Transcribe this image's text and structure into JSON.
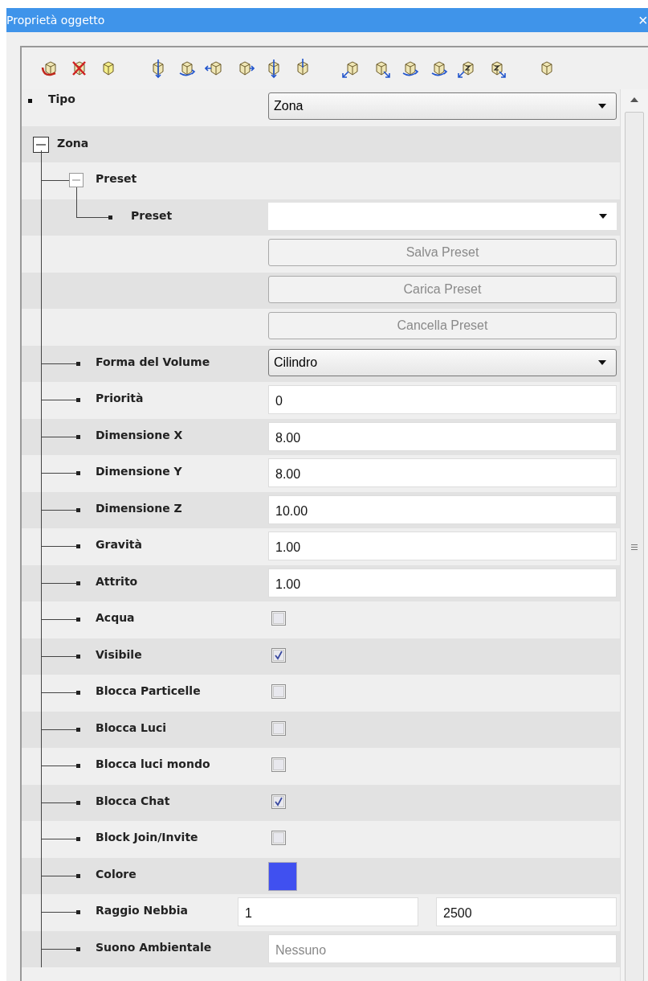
{
  "window": {
    "title": "Proprietà oggetto",
    "close": "×"
  },
  "type_row": {
    "label": "Tipo",
    "value": "Zona"
  },
  "tree": {
    "label": "Zona",
    "expanded": true,
    "children": [
      {
        "label": "Preset",
        "kind": "group",
        "expanded": true,
        "children": [
          {
            "label": "Preset",
            "kind": "dropdown"
          },
          {
            "label": "Salva Preset",
            "kind": "button",
            "disabled": true
          },
          {
            "label": "Carica Preset",
            "kind": "button",
            "disabled": true
          },
          {
            "label": "Cancella Preset",
            "kind": "button",
            "disabled": true
          }
        ]
      },
      {
        "label": "Forma del Volume",
        "kind": "dropdown",
        "value": "Cilindro"
      },
      {
        "label": "Priorità",
        "kind": "text",
        "value": "0"
      },
      {
        "label": "Dimensione X",
        "kind": "text",
        "value": "8.00"
      },
      {
        "label": "Dimensione Y",
        "kind": "text",
        "value": "8.00"
      },
      {
        "label": "Dimensione Z",
        "kind": "text",
        "value": "10.00"
      },
      {
        "label": "Gravità",
        "kind": "text",
        "value": "1.00"
      },
      {
        "label": "Attrito",
        "kind": "text",
        "value": "1.00"
      },
      {
        "label": "Acqua",
        "kind": "checkbox",
        "checked": false
      },
      {
        "label": "Visibile",
        "kind": "checkbox",
        "checked": true
      },
      {
        "label": "Blocca Particelle",
        "kind": "checkbox",
        "checked": false
      },
      {
        "label": "Blocca Luci",
        "kind": "checkbox",
        "checked": false
      },
      {
        "label": "Blocca luci mondo",
        "kind": "checkbox",
        "checked": false
      },
      {
        "label": "Blocca Chat",
        "kind": "checkbox",
        "checked": true
      },
      {
        "label": "Block Join/Invite",
        "kind": "checkbox",
        "checked": false
      },
      {
        "label": "Colore",
        "kind": "color",
        "color": "#4050f0"
      },
      {
        "label": "Raggio Nebbia",
        "kind": "range",
        "values": [
          "1",
          "2500"
        ]
      },
      {
        "label": "Suono Ambientale",
        "kind": "text",
        "placeholder": "Nessuno"
      }
    ]
  }
}
